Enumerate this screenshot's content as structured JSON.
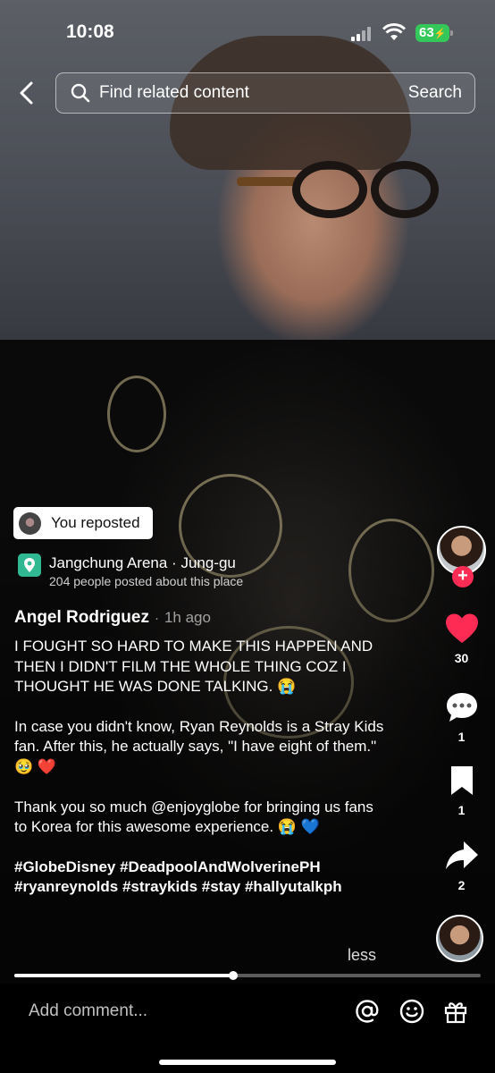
{
  "status_bar": {
    "time": "10:08",
    "battery": "63"
  },
  "search": {
    "placeholder": "Find related content",
    "button": "Search"
  },
  "repost": {
    "label": "You reposted"
  },
  "location": {
    "name": "Jangchung Arena · Jung-gu",
    "subtitle": "204 people posted about this place"
  },
  "post": {
    "author": "Angel Rodriguez",
    "separator": "·",
    "time_ago": "1h ago",
    "caption_paragraphs": [
      "I FOUGHT SO HARD TO MAKE THIS HAPPEN AND THEN I DIDN'T FILM THE WHOLE THING COZ I THOUGHT HE WAS DONE TALKING. 😭",
      "In case you didn't know, Ryan Reynolds is a Stray Kids fan. After this, he actually says, \"I have eight of them.\" 🥹 ❤️",
      "Thank you so much @enjoyglobe for bringing us fans to Korea for this awesome experience. 😭 💙"
    ],
    "hashtags": "#GlobeDisney #DeadpoolAndWolverinePH #ryanreynolds #straykids #stay #hallyutalkph",
    "less_label": "less"
  },
  "actions": {
    "likes": "30",
    "comments": "1",
    "bookmarks": "1",
    "shares": "2",
    "follow_symbol": "+"
  },
  "playback": {
    "progress": 0.47
  },
  "comment_bar": {
    "placeholder": "Add comment..."
  },
  "colors": {
    "like": "#fe2c55",
    "location_pin": "#2fb892",
    "battery": "#34c759"
  }
}
